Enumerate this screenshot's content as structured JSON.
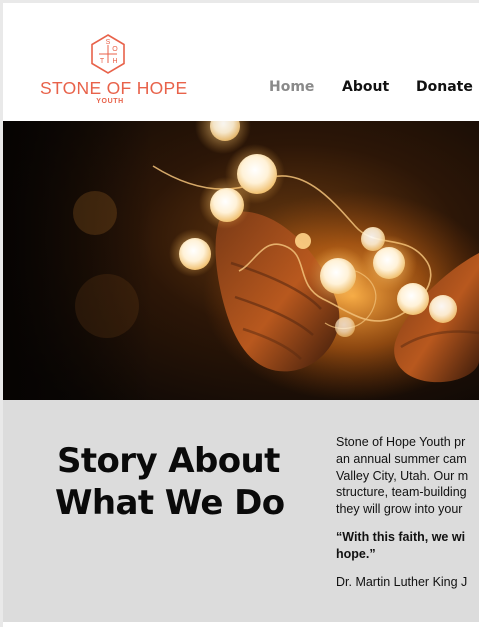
{
  "logo": {
    "monogram": [
      "S",
      "O",
      "T",
      "H"
    ],
    "name": "STONE OF HOPE",
    "subtitle": "YOUTH"
  },
  "nav": {
    "items": [
      {
        "label": "Home",
        "active": true
      },
      {
        "label": "About",
        "active": false
      },
      {
        "label": "Donate",
        "active": false
      }
    ]
  },
  "hero": {
    "image": "hands-holding-string-lights"
  },
  "story": {
    "title_lines": [
      "Story About",
      "What We Do"
    ],
    "body_lines": [
      "Stone of Hope Youth pr",
      "an annual summer cam",
      "Valley City, Utah. Our m",
      "structure, team-building",
      "they will grow into your"
    ],
    "quote_lines": [
      "“With this faith, we wi",
      "hope.”"
    ],
    "author": "Dr. Martin Luther King J"
  },
  "colors": {
    "brand": "#e8624a",
    "section_bg": "#dcdcdc",
    "nav_active": "#8a8a8a"
  }
}
